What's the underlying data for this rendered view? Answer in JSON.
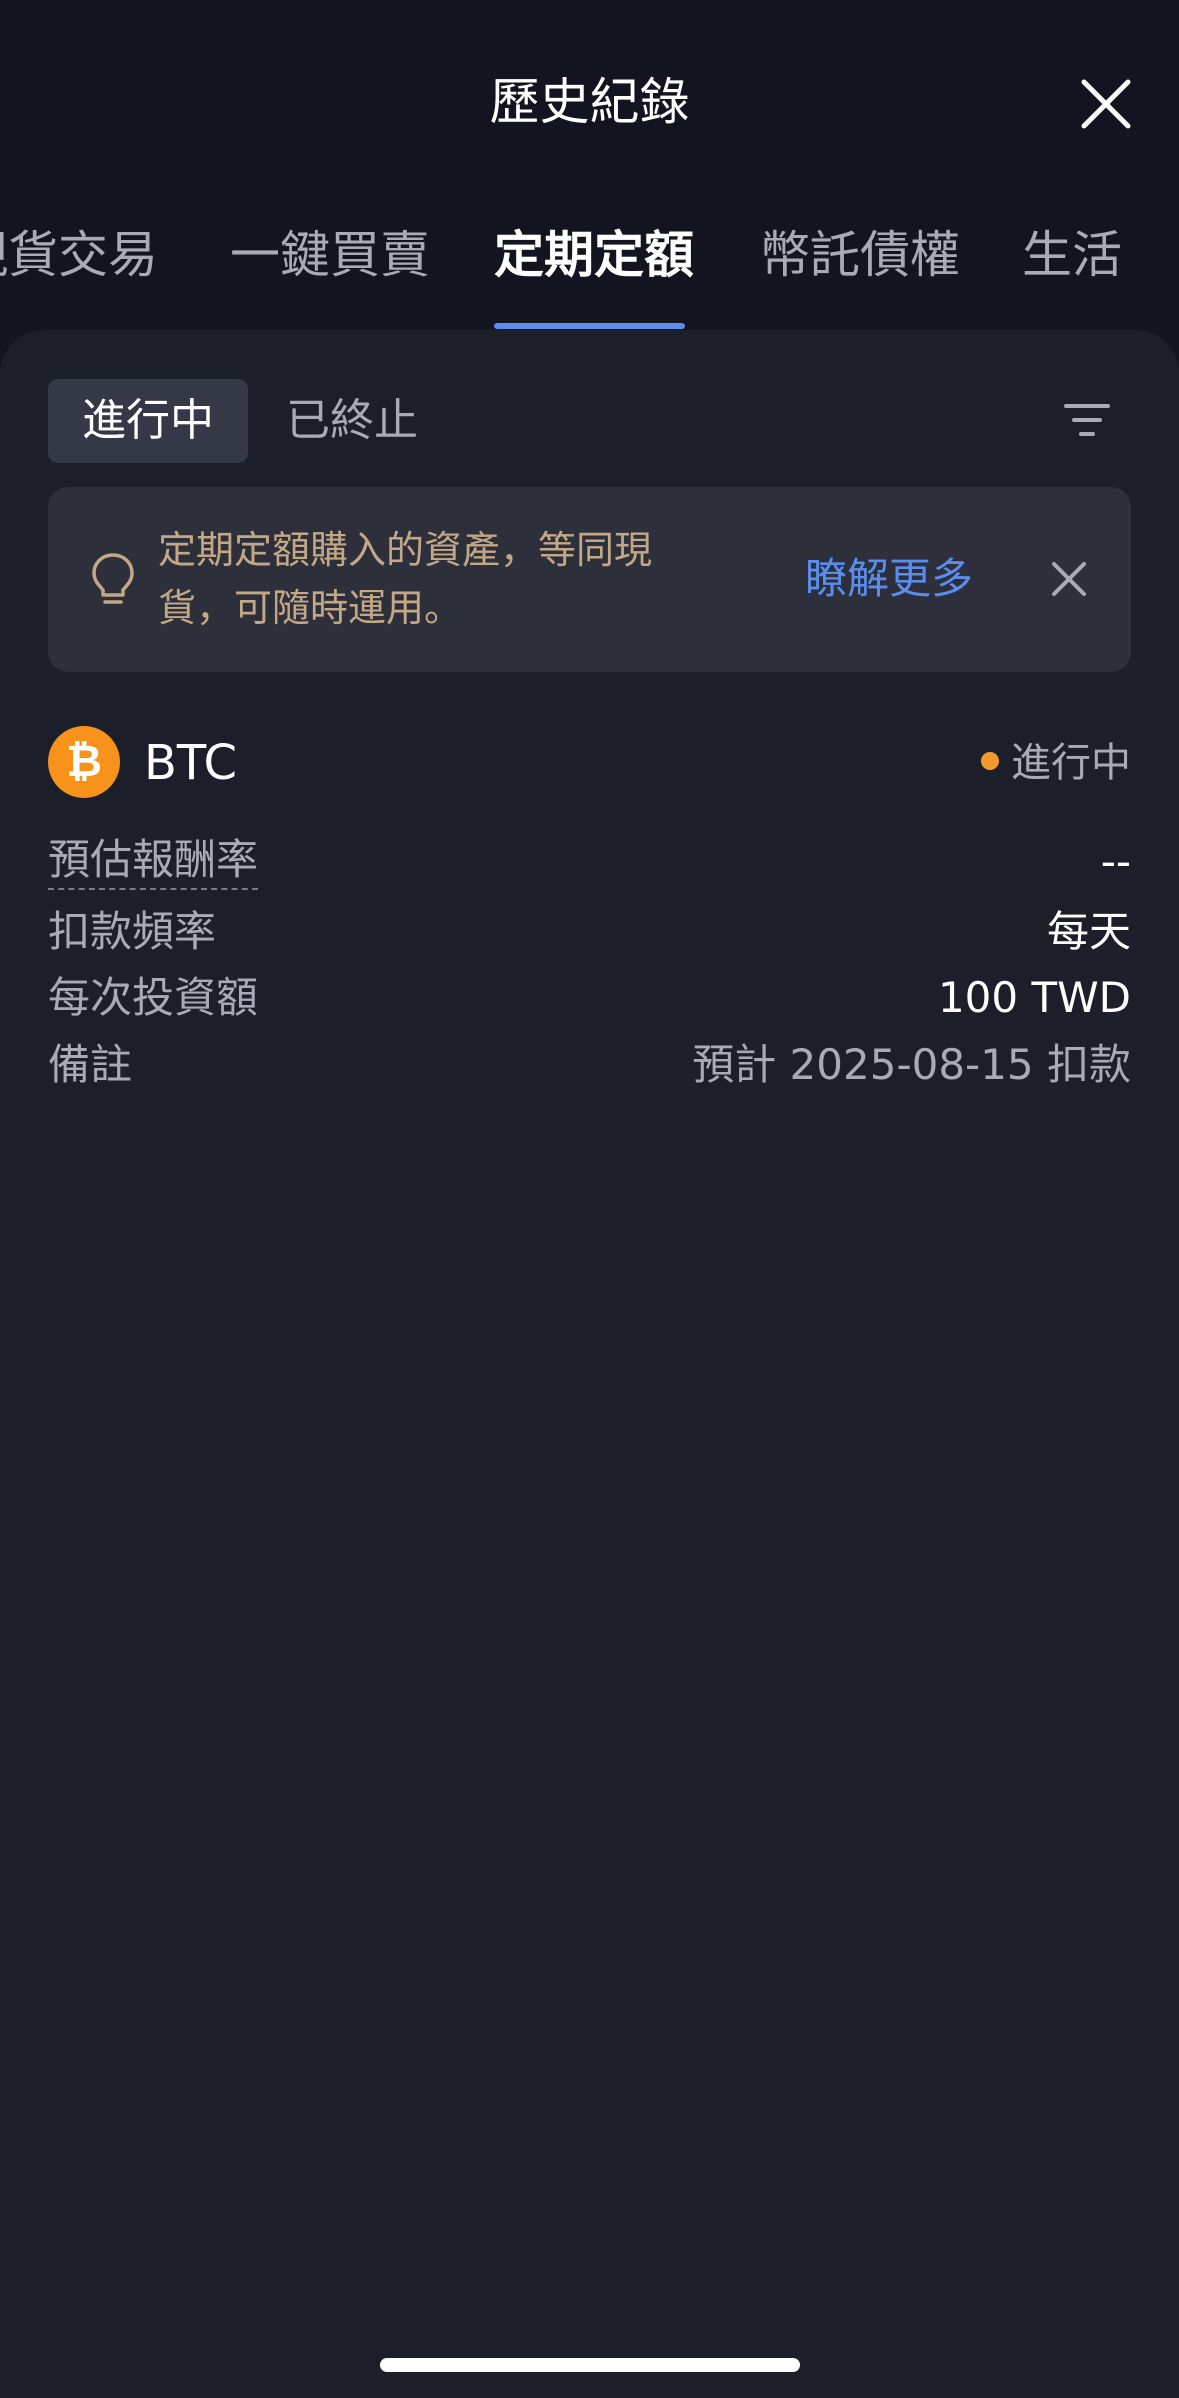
{
  "header": {
    "title": "歷史紀錄"
  },
  "tabs": [
    {
      "label": "現貨交易",
      "active": false
    },
    {
      "label": "一鍵買賣",
      "active": false
    },
    {
      "label": "定期定額",
      "active": true
    },
    {
      "label": "幣託債權",
      "active": false
    },
    {
      "label": "生活",
      "active": false
    }
  ],
  "segments": {
    "active": "進行中",
    "inactive": "已終止"
  },
  "notice": {
    "text": "定期定額購入的資產，等同現貨，可隨時運用。",
    "link_label": "瞭解更多"
  },
  "plan": {
    "coin_symbol": "BTC",
    "coin_glyph": "₿",
    "status": "進行中",
    "details": [
      {
        "label": "預估報酬率",
        "value": "--"
      },
      {
        "label": "扣款頻率",
        "value": "每天"
      },
      {
        "label": "每次投資額",
        "value": "100 TWD"
      },
      {
        "label": "備註",
        "value": "預計 2025-08-15 扣款"
      }
    ]
  },
  "colors": {
    "background": "#1c1e29",
    "header_background": "#13141f",
    "accent_blue": "#5b8def",
    "bitcoin_orange": "#f7931a",
    "status_orange": "#f39a2c",
    "notice_text": "#c2a886"
  },
  "icons": {
    "close": "close-icon",
    "filter": "filter-icon",
    "bulb": "lightbulb-icon",
    "coin": "bitcoin-icon"
  }
}
